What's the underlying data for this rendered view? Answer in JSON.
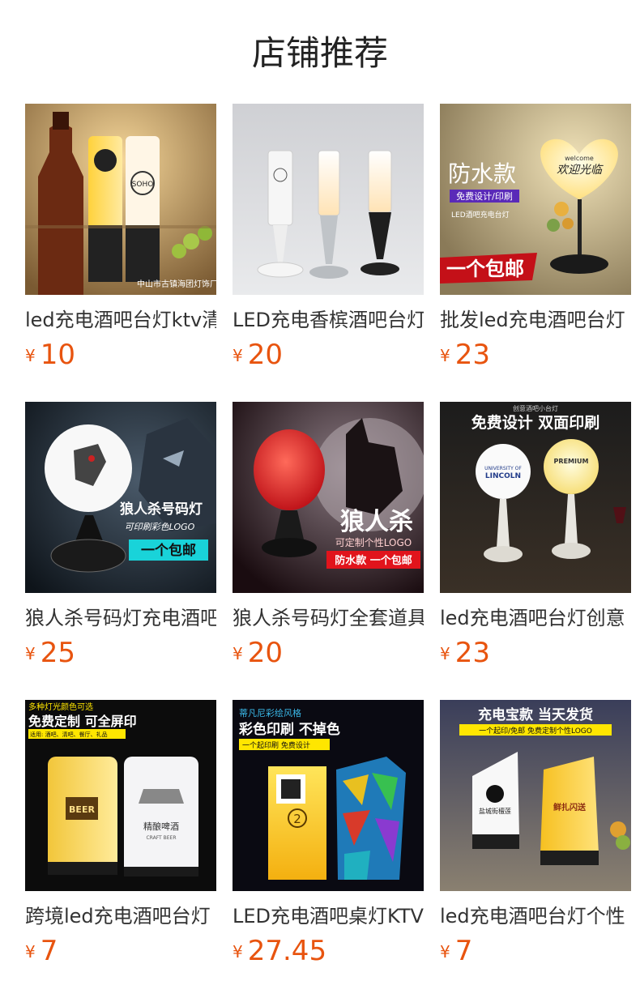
{
  "page": {
    "title": "店铺推荐"
  },
  "colors": {
    "price": "#e8540f",
    "title": "#222222",
    "name": "#333333"
  },
  "products": [
    {
      "name": "led充电酒吧台灯ktv清吧",
      "currency": "¥",
      "price": "10",
      "image_text": {
        "badge_left": "",
        "badge_right": "SOHO",
        "watermark": "中山市古镇海团灯饰厂"
      }
    },
    {
      "name": "LED充电香槟酒吧台灯",
      "currency": "¥",
      "price": "20",
      "image_text": {}
    },
    {
      "name": "批发led充电酒吧台灯",
      "currency": "¥",
      "price": "23",
      "image_text": {
        "headline": "防水款",
        "sub": "免费设计/印刷",
        "line": "LED酒吧充电台灯",
        "shade": "欢迎光临",
        "shade_top": "welcome",
        "banner": "一个包邮"
      }
    },
    {
      "name": "狼人杀号码灯充电酒吧",
      "currency": "¥",
      "price": "25",
      "image_text": {
        "headline": "狼人杀号码灯",
        "sub": "可印刷彩色LOGO",
        "banner": "一个包邮"
      }
    },
    {
      "name": "狼人杀号码灯全套道具",
      "currency": "¥",
      "price": "20",
      "image_text": {
        "headline": "狼人杀",
        "sub": "可定制个性LOGO",
        "banner": "防水款 一个包邮"
      }
    },
    {
      "name": "led充电酒吧台灯创意",
      "currency": "¥",
      "price": "23",
      "image_text": {
        "top": "创意酒吧小台灯",
        "headline": "免费设计 双面印刷",
        "left_badge": "LINCOLN",
        "left_badge_top": "UNIVERSITY OF",
        "right_badge": "PREMIUM"
      }
    },
    {
      "name": "跨境led充电酒吧台灯",
      "currency": "¥",
      "price": "7",
      "image_text": {
        "top": "多种灯光颜色可选",
        "headline": "免费定制 可全屏印",
        "sub": "适用: 酒吧、清吧、餐厅、礼品",
        "left_badge": "BEER",
        "right_badge": "精酿啤酒",
        "right_sub": "CRAFT BEER"
      }
    },
    {
      "name": "LED充电酒吧桌灯KTV",
      "currency": "¥",
      "price": "27.45",
      "image_text": {
        "top": "蒂凡尼彩绘风格",
        "headline": "彩色印刷 不掉色",
        "sub": "一个起印刷 免费设计",
        "number": "2"
      }
    },
    {
      "name": "led充电酒吧台灯个性",
      "currency": "¥",
      "price": "7",
      "image_text": {
        "headline": "充电宝款 当天发货",
        "sub": "一个起印/免邮 免费定制个性LOGO",
        "left_badge": "盐城街檀莲",
        "right_badge": "鲜扎闪送"
      }
    }
  ]
}
